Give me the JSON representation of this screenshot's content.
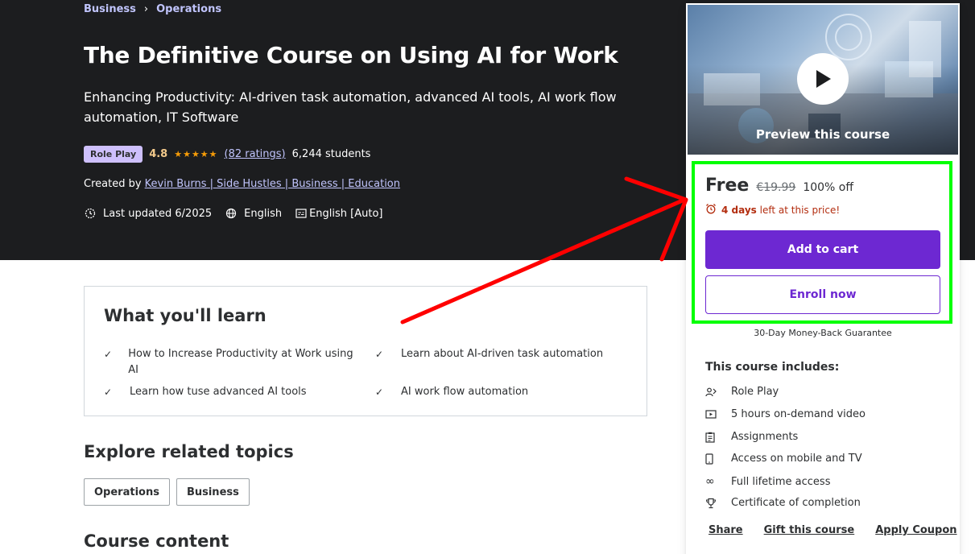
{
  "breadcrumb": {
    "items": [
      "Business",
      "Operations"
    ],
    "separator": "›"
  },
  "course": {
    "title": "The Definitive Course on Using AI for Work",
    "subtitle": "Enhancing Productivity: AI-driven task automation, advanced AI tools, AI work flow automation, IT Software",
    "badge": "Role Play",
    "rating": "4.8",
    "stars": "★★★★★",
    "ratings_count": "(82 ratings)",
    "students": "6,244 students",
    "created_by_label": "Created by",
    "instructor": "Kevin Burns | Side Hustles | Business | Education",
    "last_updated": "Last updated 6/2025",
    "language": "English",
    "captions": "English [Auto]"
  },
  "learn": {
    "title": "What you'll learn",
    "items": [
      "How to Increase Productivity at Work using AI",
      "Learn about AI-driven task automation",
      "Learn how tuse advanced AI tools",
      "AI work flow automation"
    ]
  },
  "related": {
    "title": "Explore related topics",
    "topics": [
      "Operations",
      "Business"
    ]
  },
  "content": {
    "title": "Course content"
  },
  "sidebar": {
    "preview_label": "Preview this course",
    "price": "Free",
    "old_price": "€19.99",
    "discount": "100% off",
    "timer_bold": "4 days",
    "timer_rest": "left at this price!",
    "add_to_cart": "Add to cart",
    "enroll": "Enroll now",
    "guarantee": "30-Day Money-Back Guarantee",
    "includes_title": "This course includes:",
    "includes": [
      {
        "icon": "role-play-icon",
        "label": "Role Play"
      },
      {
        "icon": "video-icon",
        "label": "5 hours on-demand video"
      },
      {
        "icon": "assignments-icon",
        "label": "Assignments"
      },
      {
        "icon": "mobile-icon",
        "label": "Access on mobile and TV"
      },
      {
        "icon": "infinity-icon",
        "label": "Full lifetime access"
      },
      {
        "icon": "trophy-icon",
        "label": "Certificate of completion"
      }
    ],
    "links": [
      "Share",
      "Gift this course",
      "Apply Coupon"
    ]
  },
  "colors": {
    "hero_bg": "#1c1d1f",
    "accent": "#6d28d2",
    "link": "#c0c4fc",
    "highlight": "#00ff00",
    "annotation_arrow": "#ff0000"
  }
}
